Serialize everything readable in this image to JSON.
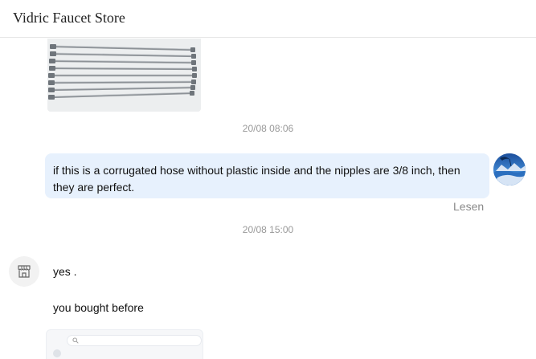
{
  "header": {
    "title": "Vidric Faucet Store"
  },
  "conversation": {
    "timestamp_1": "20/08 08:06",
    "outgoing_message": "if this is a corrugated hose without plastic inside and the nipples are 3/8 inch, then they are perfect.",
    "read_status": "Lesen",
    "timestamp_2": "20/08 15:00",
    "incoming_messages": [
      "yes .",
      "you bought before"
    ]
  },
  "icons": {
    "store_avatar": "storefront-icon",
    "user_avatar": "user-avatar-photo",
    "thumb_search": "search-icon"
  },
  "colors": {
    "outgoing_bubble": "#e7f1fd",
    "timestamp_text": "#999999",
    "read_status_text": "#8a8a8a"
  }
}
